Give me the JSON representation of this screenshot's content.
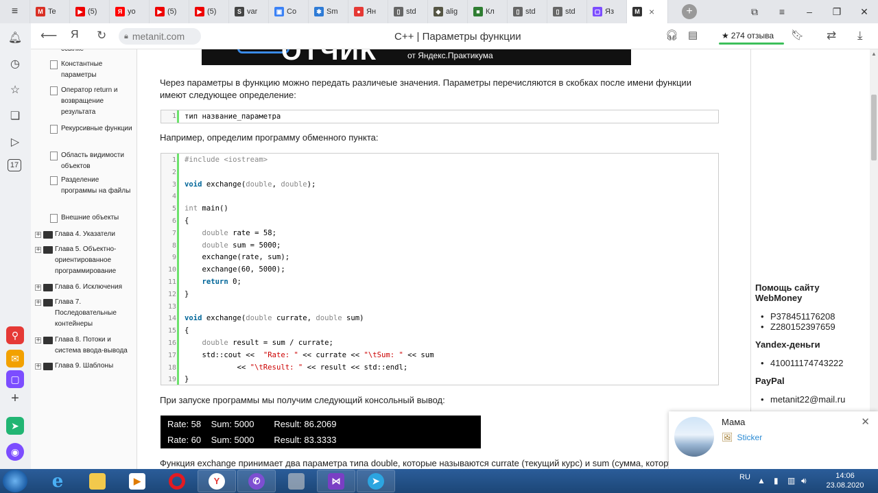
{
  "tabs": [
    {
      "label": "Te",
      "color": "#d93025",
      "glyph": "M"
    },
    {
      "label": "(5)",
      "color": "#e00",
      "glyph": "▶"
    },
    {
      "label": "yo",
      "color": "#f00",
      "glyph": "Я"
    },
    {
      "label": "(5)",
      "color": "#e00",
      "glyph": "▶"
    },
    {
      "label": "(5)",
      "color": "#e00",
      "glyph": "▶"
    },
    {
      "label": "var",
      "color": "#444",
      "glyph": "S"
    },
    {
      "label": "Co",
      "color": "#3b82f6",
      "glyph": "▣"
    },
    {
      "label": "Sm",
      "color": "#2e7bd6",
      "glyph": "✱"
    },
    {
      "label": "Ян",
      "color": "#e53935",
      "glyph": "●"
    },
    {
      "label": "std",
      "color": "#666",
      "glyph": "▯"
    },
    {
      "label": "alig",
      "color": "#554",
      "glyph": "◆"
    },
    {
      "label": "Кл",
      "color": "#2f7d32",
      "glyph": "■"
    },
    {
      "label": "std",
      "color": "#666",
      "glyph": "▯"
    },
    {
      "label": "std",
      "color": "#666",
      "glyph": "▯"
    },
    {
      "label": "Яз",
      "color": "#7c4dff",
      "glyph": "▢"
    }
  ],
  "active_tab": {
    "glyph": "M",
    "close": "×"
  },
  "address": {
    "domain": "metanit.com",
    "title": "C++ | Параметры функции",
    "reviews": "274 отзыва"
  },
  "sidebar": {
    "partial_top": "ссылке",
    "subitems": [
      "Константные параметры",
      "Оператор return и возвращение результата",
      "Рекурсивные функции",
      "Область видимости объектов",
      "Разделение программы на файлы",
      "Внешние объекты"
    ],
    "chapters": [
      "Глава 4. Указатели",
      "Глава 5. Объектно-ориентированное программирование",
      "Глава 6. Исключения",
      "Глава 7. Последовательные контейнеры",
      "Глава 8. Потоки и система ввода-вывода",
      "Глава 9. Шаблоны"
    ]
  },
  "banner": {
    "big": "ОТЧИК",
    "small": "от Яндекс.Практикума"
  },
  "content": {
    "p1_line1": "Через параметры в функцию можно передать различеые значения. Параметры перечисляются в скобках после имени функции",
    "p1_line2": "имеют следующее определение:",
    "snippet1": "тип название_параметра",
    "p2": "Например, определим программу обменного пункта:",
    "p3": "При запуске программы мы получим следующий консольный вывод:",
    "p4": "Функция exchange принимает два параметра типа double, которые называются currate (текущий курс) и sum (сумма, которую",
    "console": [
      "Rate: 58    Sum: 5000        Result: 86.2069",
      "Rate: 60    Sum: 5000        Result: 83.3333"
    ]
  },
  "right": {
    "help_title_1": "Помощь сайту",
    "help_title_2": "WebMoney",
    "webmoney": [
      "P378451176208",
      "Z280152397659"
    ],
    "yandex_title": "Yandex-деньги",
    "yandex": [
      "410011174743222"
    ],
    "paypal_title": "PayPal",
    "paypal": [
      "metanit22@mail.ru"
    ]
  },
  "notification": {
    "name": "Мама",
    "message": "Sticker"
  },
  "taskbar": {
    "lang": "RU",
    "time": "14:06",
    "date": "23.08.2020"
  }
}
